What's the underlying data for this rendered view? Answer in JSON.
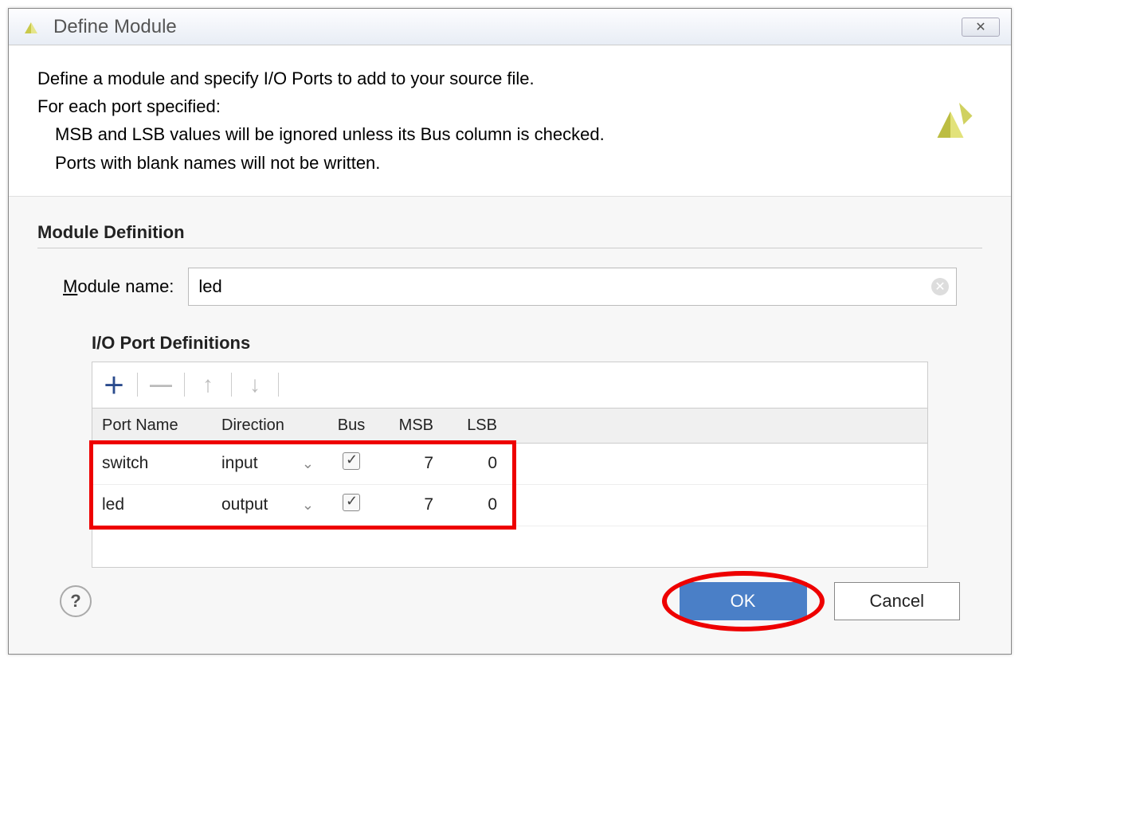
{
  "title": "Define Module",
  "description": {
    "line1": "Define a module and specify I/O Ports to add to your source file.",
    "line2": "For each port specified:",
    "line3": "MSB and LSB values will be ignored unless its Bus column is checked.",
    "line4": "Ports with blank names will not be written."
  },
  "section": {
    "title": "Module Definition",
    "module_name_label_pre": "M",
    "module_name_label_post": "odule name:",
    "module_name_value": "led",
    "io_title": "I/O Port Definitions"
  },
  "columns": {
    "port": "Port Name",
    "direction": "Direction",
    "bus": "Bus",
    "msb": "MSB",
    "lsb": "LSB"
  },
  "rows": [
    {
      "port": "switch",
      "direction": "input",
      "bus": true,
      "msb": "7",
      "lsb": "0"
    },
    {
      "port": "led",
      "direction": "output",
      "bus": true,
      "msb": "7",
      "lsb": "0"
    }
  ],
  "buttons": {
    "ok": "OK",
    "cancel": "Cancel"
  },
  "icons": {
    "close": "✕",
    "help": "?",
    "clear": "✕",
    "add": "＋",
    "remove": "—",
    "up": "↑",
    "down": "↓",
    "chevron": "⌄"
  }
}
